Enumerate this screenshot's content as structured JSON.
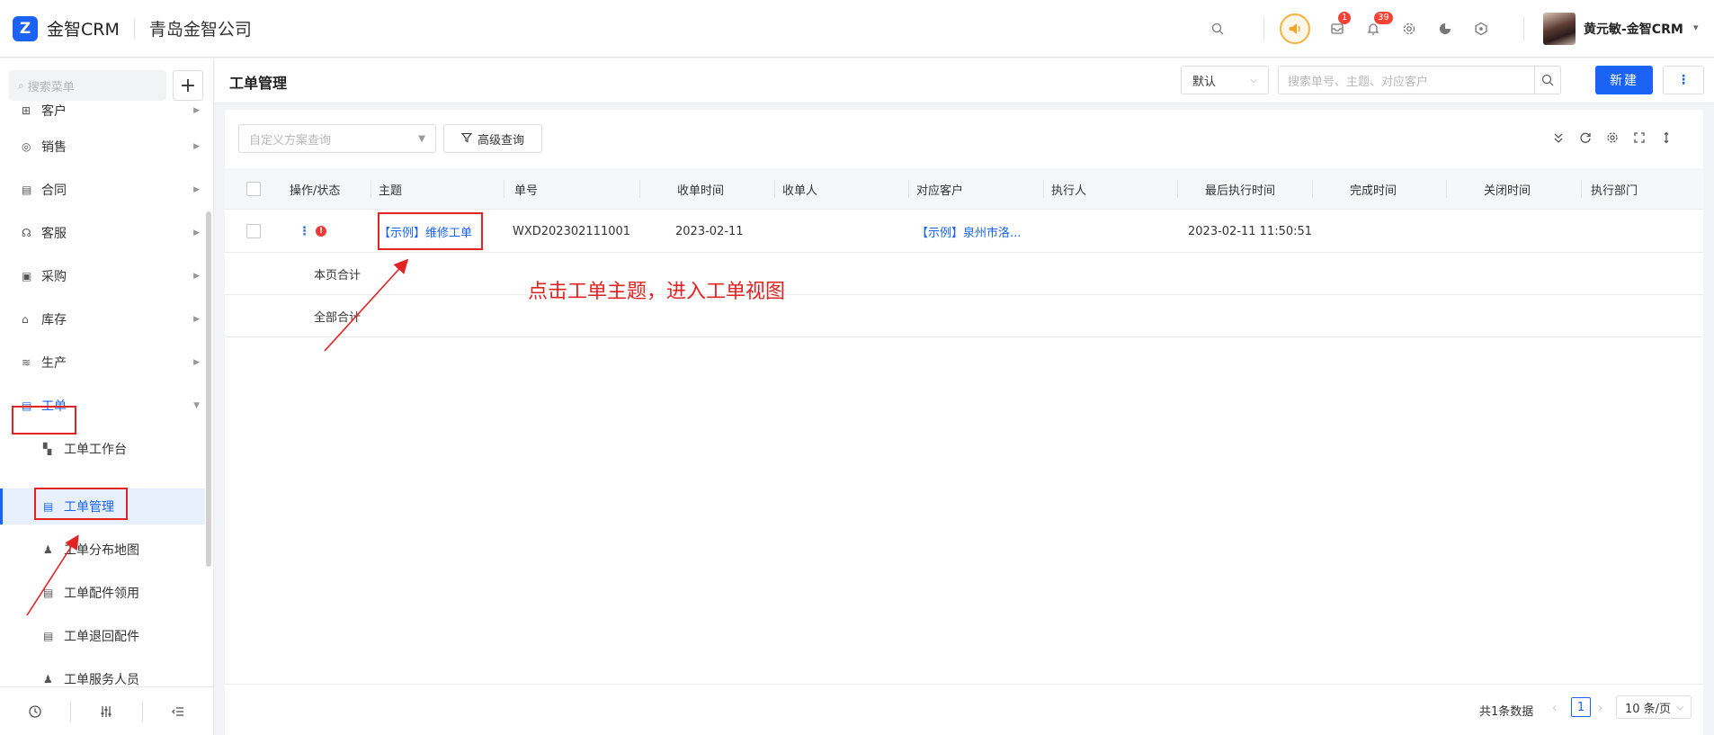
{
  "header": {
    "logo_mark": "Z",
    "app_name": "金智CRM",
    "company": "青岛金智公司",
    "messages_badge": "1",
    "notifications_badge": "39",
    "username": "黄元敏-金智CRM"
  },
  "sidebar": {
    "search_placeholder": "搜索菜单",
    "add_label": "+",
    "menu": [
      {
        "label": "客户",
        "icon": "customer-icon",
        "glyph": "⊞"
      },
      {
        "label": "销售",
        "icon": "sales-icon",
        "glyph": "◎"
      },
      {
        "label": "合同",
        "icon": "contract-icon",
        "glyph": "▤"
      },
      {
        "label": "客服",
        "icon": "service-icon",
        "glyph": "☊"
      },
      {
        "label": "采购",
        "icon": "purchase-icon",
        "glyph": "▣"
      },
      {
        "label": "库存",
        "icon": "inventory-icon",
        "glyph": "⌂"
      },
      {
        "label": "生产",
        "icon": "production-icon",
        "glyph": "≋"
      },
      {
        "label": "工单",
        "icon": "workorder-icon",
        "glyph": "▤"
      }
    ],
    "submenu": [
      {
        "label": "工单工作台",
        "icon": "dashboard-icon",
        "glyph": "▚"
      },
      {
        "label": "工单管理",
        "icon": "document-icon",
        "glyph": "▤"
      },
      {
        "label": "工单分布地图",
        "icon": "person-icon",
        "glyph": "♟"
      },
      {
        "label": "工单配件领用",
        "icon": "file-icon",
        "glyph": "▤"
      },
      {
        "label": "工单退回配件",
        "icon": "file-icon",
        "glyph": "▤"
      },
      {
        "label": "工单服务人员",
        "icon": "person-icon",
        "glyph": "♟"
      }
    ]
  },
  "page": {
    "title": "工单管理",
    "view_select": "默认",
    "search_placeholder": "搜索单号、主题、对应客户",
    "new_button": "新建",
    "scheme_placeholder": "自定义方案查询",
    "advanced_query": "高级查询"
  },
  "table": {
    "columns": [
      "操作/状态",
      "主题",
      "单号",
      "收单时间",
      "收单人",
      "对应客户",
      "执行人",
      "最后执行时间",
      "完成时间",
      "关闭时间",
      "执行部门"
    ],
    "row": {
      "subject": "【示例】维修工单",
      "number": "WXD202302111001",
      "received_time": "2023-02-11",
      "receiver": "",
      "customer": "【示例】泉州市洛...",
      "executor": "",
      "last_exec_time": "2023-02-11 11:50:51",
      "finish_time": "",
      "close_time": "",
      "department": ""
    },
    "page_total_label": "本页合计",
    "all_total_label": "全部合计"
  },
  "pagination": {
    "total": "共1条数据",
    "current_page": "1",
    "page_size": "10 条/页"
  },
  "annotation": {
    "text": "点击工单主题，进入工单视图"
  },
  "colors": {
    "primary": "#1a63f5",
    "annotation_red": "#e32222",
    "speaker_orange": "#f3a422"
  }
}
